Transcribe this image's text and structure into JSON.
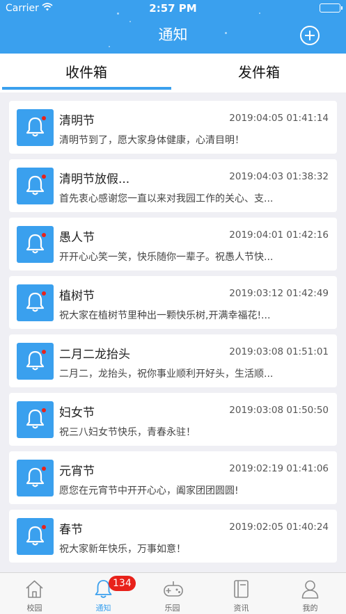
{
  "status_bar": {
    "carrier": "Carrier",
    "time": "2:57 PM"
  },
  "nav": {
    "title": "通知"
  },
  "tabs": {
    "inbox": "收件箱",
    "outbox": "发件箱"
  },
  "notices": [
    {
      "title": "清明节",
      "time": "2019:04:05 01:41:14",
      "summary": "清明节到了，愿大家身体健康，心清目明！"
    },
    {
      "title": "清明节放假...",
      "time": "2019:04:03 01:38:32",
      "summary": "首先衷心感谢您一直以来对我园工作的关心、支..."
    },
    {
      "title": "愚人节",
      "time": "2019:04:01 01:42:16",
      "summary": "开开心心笑一笑，快乐随你一辈子。祝愚人节快..."
    },
    {
      "title": "植树节",
      "time": "2019:03:12 01:42:49",
      "summary": "祝大家在植树节里种出一颗快乐树,开满幸福花!..."
    },
    {
      "title": "二月二龙抬头",
      "time": "2019:03:08 01:51:01",
      "summary": "二月二，龙抬头，祝你事业顺利开好头，生活顺..."
    },
    {
      "title": "妇女节",
      "time": "2019:03:08 01:50:50",
      "summary": "祝三八妇女节快乐，青春永驻！"
    },
    {
      "title": "元宵节",
      "time": "2019:02:19 01:41:06",
      "summary": "愿您在元宵节中开开心心，阖家团团圆圆!"
    },
    {
      "title": "春节",
      "time": "2019:02:05 01:40:24",
      "summary": "祝大家新年快乐，万事如意！"
    }
  ],
  "tabbar": {
    "items": [
      {
        "label": "校园",
        "icon": "home-icon"
      },
      {
        "label": "通知",
        "icon": "bell-icon",
        "badge": "134"
      },
      {
        "label": "乐园",
        "icon": "gamepad-icon"
      },
      {
        "label": "资讯",
        "icon": "book-icon"
      },
      {
        "label": "我的",
        "icon": "user-icon"
      }
    ]
  },
  "colors": {
    "primary": "#3aa0ee",
    "badge": "#e8221b",
    "background": "#efeff4"
  }
}
